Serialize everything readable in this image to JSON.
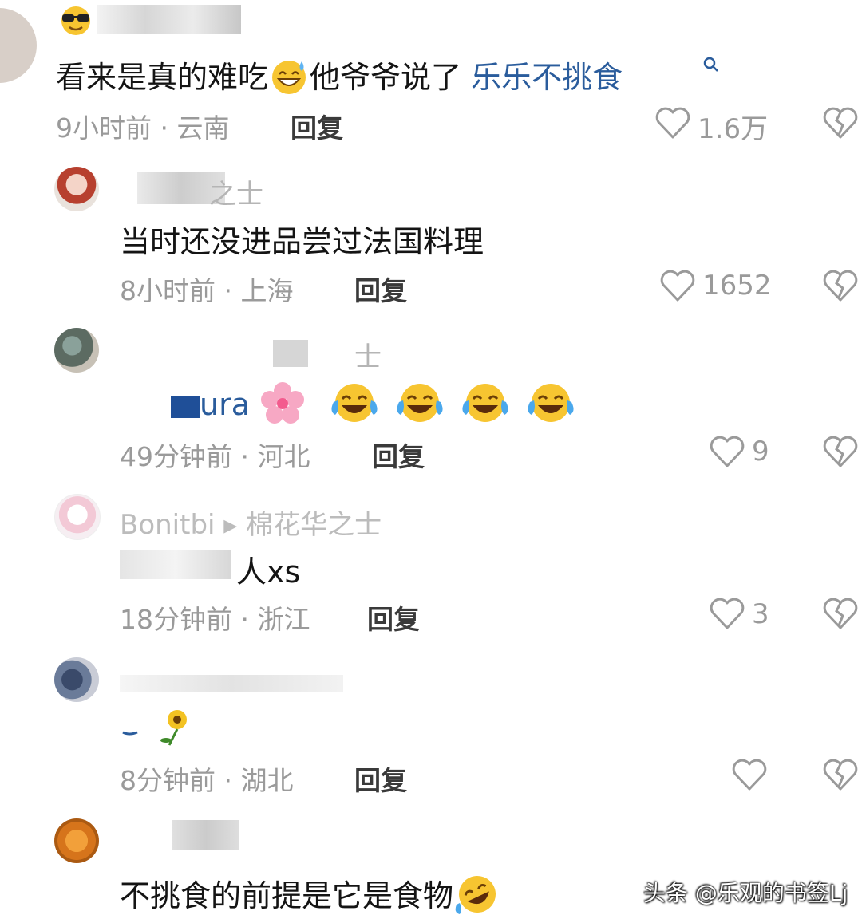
{
  "comments": [
    {
      "username": "",
      "text": "看来是真的难吃",
      "text_after_emoji": "他爷爷说了",
      "link_text": "乐乐不挑食",
      "time": "9小时前 · 云南",
      "reply": "回复",
      "likes": "1.6万"
    },
    {
      "username": "之士",
      "text": "当时还没进品尝过法国料理",
      "time": "8小时前 · 上海",
      "reply": "回复",
      "likes": "1652"
    },
    {
      "username": "士",
      "text": "ura",
      "time": "49分钟前 · 河北",
      "reply": "回复",
      "likes": "9"
    },
    {
      "username": "Bonitbi ▸ 棉花华之士",
      "text": "人xs",
      "time": "18分钟前 · 浙江",
      "reply": "回复",
      "likes": "3"
    },
    {
      "username": "",
      "text": "",
      "time": "8分钟前 · 湖北",
      "reply": "回复",
      "likes": ""
    },
    {
      "username": "",
      "text": "不挑食的前提是它是食物",
      "time": "",
      "reply": "",
      "likes": ""
    }
  ],
  "icons": {
    "like": "heart-outline-icon",
    "dislike": "broken-heart-icon",
    "search": "search-icon"
  },
  "colors": {
    "link": "#2a5c9c",
    "meta": "#9a9a9a"
  },
  "watermark": "头条 @乐观的书签Lj"
}
